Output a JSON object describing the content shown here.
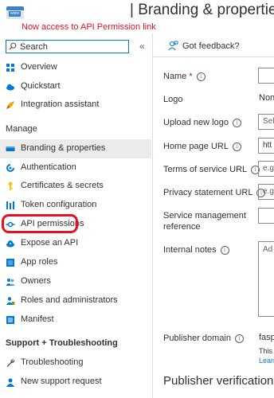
{
  "header": {
    "app_icon_text": "www",
    "title": "| Branding & properties",
    "annotation": "Now access to API Permission link"
  },
  "search": {
    "value": "Search",
    "placeholder": "Search"
  },
  "nav": {
    "top_items": [
      {
        "label": "Overview",
        "icon": "grid-icon"
      },
      {
        "label": "Quickstart",
        "icon": "cloud-icon"
      },
      {
        "label": "Integration assistant",
        "icon": "rocket-icon"
      }
    ],
    "manage_header": "Manage",
    "manage_items": [
      {
        "label": "Branding & properties",
        "icon": "branding-icon",
        "selected": true
      },
      {
        "label": "Authentication",
        "icon": "authentication-icon"
      },
      {
        "label": "Certificates & secrets",
        "icon": "key-icon"
      },
      {
        "label": "Token configuration",
        "icon": "token-icon"
      },
      {
        "label": "API permissions",
        "icon": "api-permissions-icon"
      },
      {
        "label": "Expose an API",
        "icon": "cloud-api-icon"
      },
      {
        "label": "App roles",
        "icon": "app-roles-icon"
      },
      {
        "label": "Owners",
        "icon": "people-icon"
      },
      {
        "label": "Roles and administrators",
        "icon": "roles-icon"
      },
      {
        "label": "Manifest",
        "icon": "manifest-icon"
      }
    ],
    "support_header": "Support + Troubleshooting",
    "support_items": [
      {
        "label": "Troubleshooting",
        "icon": "wrench-icon"
      },
      {
        "label": "New support request",
        "icon": "support-person-icon"
      }
    ]
  },
  "toolbar": {
    "feedback_label": "Got feedback?"
  },
  "form": {
    "name_label": "Name",
    "required_marker": "*",
    "logo_label": "Logo",
    "logo_value": "None",
    "upload_logo_label": "Upload new logo",
    "upload_logo_value": "Sel",
    "home_page_label": "Home page URL",
    "home_page_value": "htt",
    "terms_label": "Terms of service URL",
    "terms_placeholder": "e.g",
    "privacy_label": "Privacy statement URL",
    "privacy_placeholder": "e.g",
    "service_mgmt_label_line1": "Service management",
    "service_mgmt_label_line2": "reference",
    "internal_notes_label": "Internal notes",
    "internal_notes_placeholder": "Ad",
    "publisher_domain_label": "Publisher domain",
    "publisher_domain_value": "fasps",
    "publisher_domain_note": "This c",
    "publisher_domain_link": "Learn",
    "publisher_verification_title": "Publisher verification"
  },
  "colors": {
    "accent": "#0078d4",
    "annotation": "#e81123",
    "selected_bg": "#edebe9"
  }
}
